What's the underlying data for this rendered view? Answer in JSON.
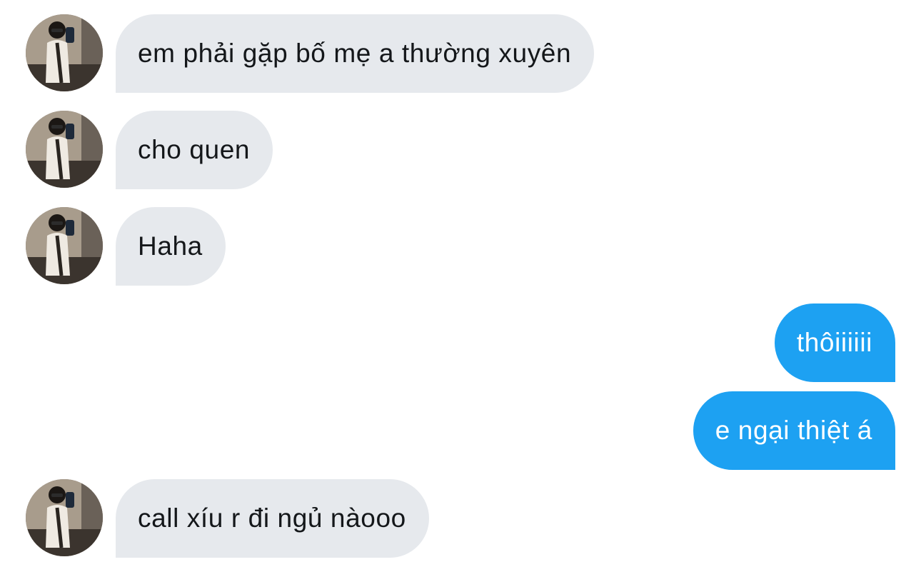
{
  "conversation": {
    "messages": [
      {
        "sender": "other",
        "text": "em phải gặp bố mẹ a thường xuyên"
      },
      {
        "sender": "other",
        "text": "cho quen"
      },
      {
        "sender": "other",
        "text": "Haha"
      },
      {
        "sender": "me",
        "text": "thôiiiiii"
      },
      {
        "sender": "me",
        "text": "e ngại thiệt á"
      },
      {
        "sender": "other",
        "text": "call xíu r đi ngủ nàooo"
      }
    ]
  },
  "colors": {
    "incoming_bubble": "#e6e9ed",
    "outgoing_bubble": "#1da1f2",
    "incoming_text": "#14171a",
    "outgoing_text": "#ffffff",
    "background": "#ffffff"
  },
  "icons": {
    "avatar": "user-photo-avatar"
  }
}
